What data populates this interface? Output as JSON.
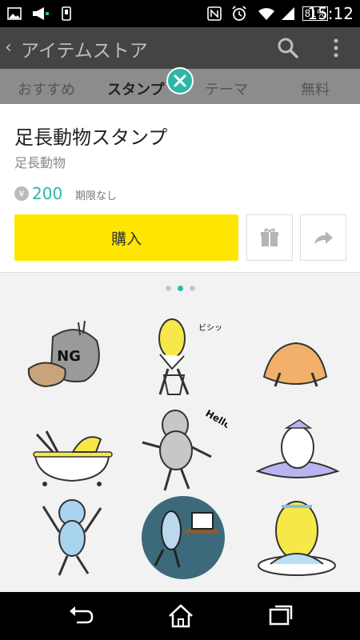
{
  "status_bar": {
    "battery": "81%",
    "time": "15:12"
  },
  "header": {
    "back_glyph": "‹",
    "title": "アイテムストア"
  },
  "tabs": [
    {
      "label": "おすすめ",
      "active": false
    },
    {
      "label": "スタンプ",
      "active": true
    },
    {
      "label": "テーマ",
      "active": false
    },
    {
      "label": "無料",
      "active": false
    }
  ],
  "detail": {
    "title": "足長動物スタンプ",
    "author": "足長動物",
    "currency_symbol": "¥",
    "price": "200",
    "validity": "期限なし",
    "buy_label": "購入"
  },
  "stickers": [
    {
      "text": "NG"
    },
    {
      "text": "ビシッ"
    },
    {
      "text": ""
    },
    {
      "text": ""
    },
    {
      "text": "Hello"
    },
    {
      "text": ""
    },
    {
      "text": ""
    },
    {
      "text": ""
    },
    {
      "text": ""
    }
  ],
  "pager": {
    "current": 2,
    "total": 3
  },
  "colors": {
    "accent": "#2cb7a8",
    "buy": "#ffe600",
    "sticker_yellow": "#f7e84a"
  }
}
